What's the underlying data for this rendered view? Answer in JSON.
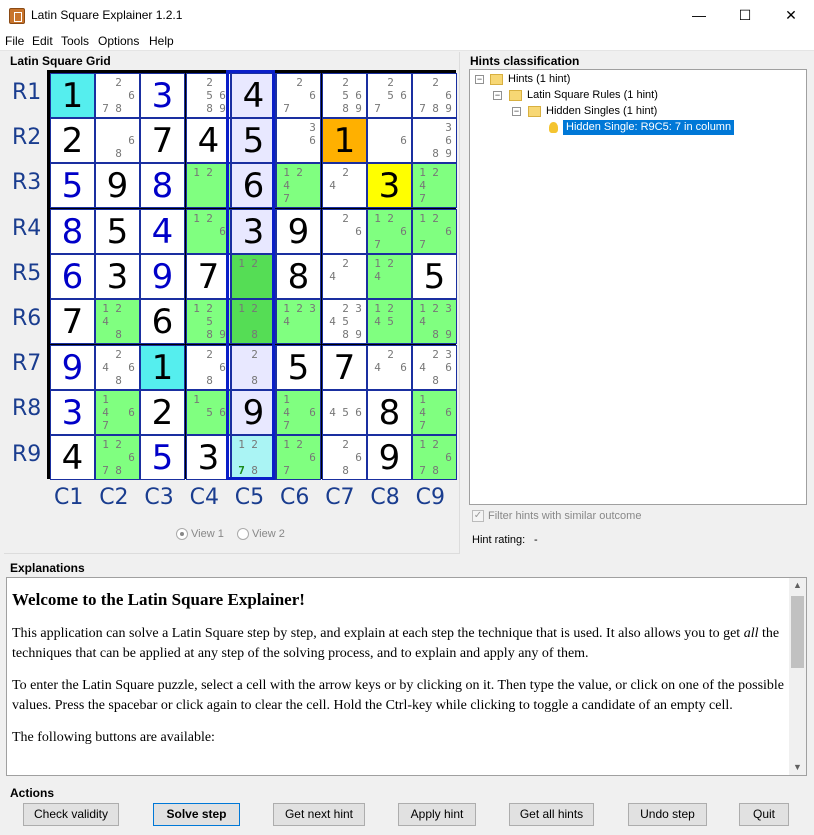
{
  "window": {
    "title": "Latin Square Explainer 1.2.1",
    "minimize": "—",
    "maximize": "☐",
    "close": "✕"
  },
  "menu": [
    "File",
    "Edit",
    "Tools",
    "Options",
    "Help"
  ],
  "grid_panel": {
    "title": "Latin Square Grid"
  },
  "row_labels": [
    "R1",
    "R2",
    "R3",
    "R4",
    "R5",
    "R6",
    "R7",
    "R8",
    "R9"
  ],
  "col_labels": [
    "C1",
    "C2",
    "C3",
    "C4",
    "C5",
    "C6",
    "C7",
    "C8",
    "C9"
  ],
  "colors": {
    "given": "#0000c8",
    "entered": "#000000",
    "cyan": "#55eeee",
    "light_cyan": "#aaf4f4",
    "green": "#80ff80",
    "dark_green": "#55dd55",
    "orange": "#ffb000",
    "yellow": "#ffff00",
    "col_highlight": "#e8e8ff",
    "selection": "#0078d7"
  },
  "cells": [
    [
      {
        "v": "1",
        "c": "b",
        "bg": "cyan"
      },
      {
        "cand": [
          "",
          "2",
          "",
          "",
          "",
          "6",
          "7",
          "8",
          ""
        ]
      },
      {
        "v": "3",
        "c": "g"
      },
      {
        "cand": [
          "",
          "2",
          "",
          "",
          "5",
          "6",
          "",
          "8",
          "9"
        ]
      },
      {
        "v": "4",
        "c": "b",
        "bg": "col"
      },
      {
        "cand": [
          "",
          "2",
          "",
          "",
          "",
          "6",
          "7",
          "",
          ""
        ]
      },
      {
        "cand": [
          "",
          "2",
          "",
          "",
          "5",
          "6",
          "",
          "8",
          "9"
        ]
      },
      {
        "cand": [
          "",
          "2",
          "",
          "",
          "5",
          "6",
          "7",
          "",
          ""
        ]
      },
      {
        "cand": [
          "",
          "2",
          "",
          "",
          "",
          "6",
          "7",
          "8",
          "9"
        ]
      }
    ],
    [
      {
        "v": "2",
        "c": "b"
      },
      {
        "cand": [
          "",
          "",
          "",
          "",
          "",
          "6",
          "",
          "8",
          ""
        ]
      },
      {
        "v": "7",
        "c": "b"
      },
      {
        "v": "4",
        "c": "b"
      },
      {
        "v": "5",
        "c": "b",
        "bg": "col"
      },
      {
        "cand": [
          "",
          "",
          "3",
          "",
          "",
          "6",
          "",
          "",
          ""
        ]
      },
      {
        "v": "1",
        "c": "b",
        "bg": "orange"
      },
      {
        "cand": [
          "",
          "",
          "",
          "",
          "",
          "6",
          "",
          "",
          ""
        ]
      },
      {
        "cand": [
          "",
          "",
          "3",
          "",
          "",
          "6",
          "",
          "8",
          "9"
        ]
      }
    ],
    [
      {
        "v": "5",
        "c": "g"
      },
      {
        "v": "9",
        "c": "b"
      },
      {
        "v": "8",
        "c": "g"
      },
      {
        "cand": [
          "1",
          "2",
          "",
          "",
          "",
          "",
          "",
          "",
          ""
        ],
        "bg": "green"
      },
      {
        "v": "6",
        "c": "b",
        "bg": "col"
      },
      {
        "cand": [
          "1",
          "2",
          "",
          "4",
          "",
          "",
          "7",
          "",
          ""
        ],
        "bg": "green"
      },
      {
        "cand": [
          "",
          "2",
          "",
          "4",
          "",
          "",
          "",
          "",
          ""
        ]
      },
      {
        "v": "3",
        "c": "b",
        "bg": "yellow"
      },
      {
        "cand": [
          "1",
          "2",
          "",
          "4",
          "",
          "",
          "7",
          "",
          ""
        ],
        "bg": "green"
      }
    ],
    [
      {
        "v": "8",
        "c": "g"
      },
      {
        "v": "5",
        "c": "b"
      },
      {
        "v": "4",
        "c": "g"
      },
      {
        "cand": [
          "1",
          "2",
          "",
          "",
          "",
          "6",
          "",
          "",
          ""
        ],
        "bg": "green"
      },
      {
        "v": "3",
        "c": "b",
        "bg": "col"
      },
      {
        "v": "9",
        "c": "b"
      },
      {
        "cand": [
          "",
          "2",
          "",
          "",
          "",
          "6",
          "",
          "",
          ""
        ]
      },
      {
        "cand": [
          "1",
          "2",
          "",
          "",
          "",
          "6",
          "7",
          "",
          ""
        ],
        "bg": "green"
      },
      {
        "cand": [
          "1",
          "2",
          "",
          "",
          "",
          "6",
          "7",
          "",
          ""
        ],
        "bg": "green"
      }
    ],
    [
      {
        "v": "6",
        "c": "g"
      },
      {
        "v": "3",
        "c": "b"
      },
      {
        "v": "9",
        "c": "g"
      },
      {
        "v": "7",
        "c": "b"
      },
      {
        "cand": [
          "1",
          "2",
          "",
          "",
          "",
          "",
          "",
          "",
          ""
        ],
        "bg": "dgreen"
      },
      {
        "v": "8",
        "c": "b"
      },
      {
        "cand": [
          "",
          "2",
          "",
          "4",
          "",
          "",
          "",
          "",
          ""
        ]
      },
      {
        "cand": [
          "1",
          "2",
          "",
          "4",
          "",
          "",
          "",
          "",
          ""
        ],
        "bg": "green"
      },
      {
        "v": "5",
        "c": "b"
      }
    ],
    [
      {
        "v": "7",
        "c": "b"
      },
      {
        "cand": [
          "1",
          "2",
          "",
          "4",
          "",
          "",
          "",
          "8",
          ""
        ],
        "bg": "green"
      },
      {
        "v": "6",
        "c": "b"
      },
      {
        "cand": [
          "1",
          "2",
          "",
          "",
          "5",
          "",
          "",
          "8",
          "9"
        ],
        "bg": "green"
      },
      {
        "cand": [
          "1",
          "2",
          "",
          "",
          "",
          "",
          "",
          "8",
          ""
        ],
        "bg": "dgreen"
      },
      {
        "cand": [
          "1",
          "2",
          "3",
          "4",
          "",
          "",
          "",
          "",
          ""
        ],
        "bg": "green"
      },
      {
        "cand": [
          "",
          "2",
          "3",
          "4",
          "5",
          "",
          "",
          "8",
          "9"
        ]
      },
      {
        "cand": [
          "1",
          "2",
          "",
          "4",
          "5",
          "",
          "",
          "",
          ""
        ],
        "bg": "green"
      },
      {
        "cand": [
          "1",
          "2",
          "3",
          "4",
          "",
          "",
          "",
          "8",
          "9"
        ],
        "bg": "green"
      }
    ],
    [
      {
        "v": "9",
        "c": "g"
      },
      {
        "cand": [
          "",
          "2",
          "",
          "4",
          "",
          "6",
          "",
          "8",
          ""
        ]
      },
      {
        "v": "1",
        "c": "b",
        "bg": "cyan"
      },
      {
        "cand": [
          "",
          "2",
          "",
          "",
          "",
          "6",
          "",
          "8",
          ""
        ]
      },
      {
        "cand": [
          "",
          "2",
          "",
          "",
          "",
          "",
          "",
          "8",
          ""
        ],
        "bg": "col"
      },
      {
        "v": "5",
        "c": "b"
      },
      {
        "v": "7",
        "c": "b"
      },
      {
        "cand": [
          "",
          "2",
          "",
          "4",
          "",
          "6",
          "",
          "",
          ""
        ]
      },
      {
        "cand": [
          "",
          "2",
          "3",
          "4",
          "",
          "6",
          "",
          "8",
          ""
        ]
      }
    ],
    [
      {
        "v": "3",
        "c": "g"
      },
      {
        "cand": [
          "1",
          "",
          "",
          "4",
          "",
          "6",
          "7",
          "",
          ""
        ],
        "bg": "green"
      },
      {
        "v": "2",
        "c": "b"
      },
      {
        "cand": [
          "1",
          "",
          "",
          "",
          "5",
          "6",
          "",
          "",
          ""
        ],
        "bg": "green"
      },
      {
        "v": "9",
        "c": "b",
        "bg": "col"
      },
      {
        "cand": [
          "1",
          "",
          "",
          "4",
          "",
          "6",
          "7",
          "",
          ""
        ],
        "bg": "green"
      },
      {
        "cand": [
          "",
          "",
          "",
          "4",
          "5",
          "6",
          "",
          "",
          ""
        ]
      },
      {
        "v": "8",
        "c": "b"
      },
      {
        "cand": [
          "1",
          "",
          "",
          "4",
          "",
          "6",
          "7",
          "",
          ""
        ],
        "bg": "green"
      }
    ],
    [
      {
        "v": "4",
        "c": "b"
      },
      {
        "cand": [
          "1",
          "2",
          "",
          "",
          "",
          "6",
          "7",
          "8",
          ""
        ],
        "bg": "green"
      },
      {
        "v": "5",
        "c": "g"
      },
      {
        "v": "3",
        "c": "b"
      },
      {
        "cand": [
          "1",
          "2",
          "",
          "",
          "",
          "",
          "7",
          "8",
          ""
        ],
        "bg": "lcyan",
        "hl": "7"
      },
      {
        "cand": [
          "1",
          "2",
          "",
          "",
          "",
          "6",
          "7",
          "",
          ""
        ],
        "bg": "green"
      },
      {
        "cand": [
          "",
          "2",
          "",
          "",
          "",
          "6",
          "",
          "8",
          ""
        ]
      },
      {
        "v": "9",
        "c": "b"
      },
      {
        "cand": [
          "1",
          "2",
          "",
          "",
          "",
          "6",
          "7",
          "8",
          ""
        ],
        "bg": "green"
      }
    ]
  ],
  "views": {
    "view1": "View 1",
    "view2": "View 2"
  },
  "hints_panel": {
    "title": "Hints classification",
    "tree": [
      {
        "label": "Hints (1 hint)",
        "level": 0
      },
      {
        "label": "Latin Square Rules (1 hint)",
        "level": 1
      },
      {
        "label": "Hidden Singles (1 hint)",
        "level": 2
      },
      {
        "label": "Hidden Single: R9C5: 7 in column",
        "level": 3
      }
    ],
    "filter_label": "Filter hints with similar outcome",
    "rating_label": "Hint rating:",
    "rating_value": "-"
  },
  "explanations": {
    "title": "Explanations",
    "heading": "Welcome to the Latin Square Explainer!",
    "p1a": "This application can solve a Latin Square step by step, and explain at each step the technique that is used. It also allows you to get ",
    "p1em": "all",
    "p1b": " the techniques that can be applied at any step of the solving process, and to explain and apply any of them.",
    "p2": "To enter the Latin Square puzzle, select a cell with the arrow keys or by clicking on it. Then type the value, or click on one of the possible values. Press the spacebar or click again to clear the cell. Hold the Ctrl-key while clicking to toggle a candidate of an empty cell.",
    "p3": "The following buttons are available:"
  },
  "actions": {
    "title": "Actions",
    "buttons": [
      "Check validity",
      "Solve step",
      "Get next hint",
      "Apply hint",
      "Get all hints",
      "Undo step",
      "Quit"
    ]
  }
}
